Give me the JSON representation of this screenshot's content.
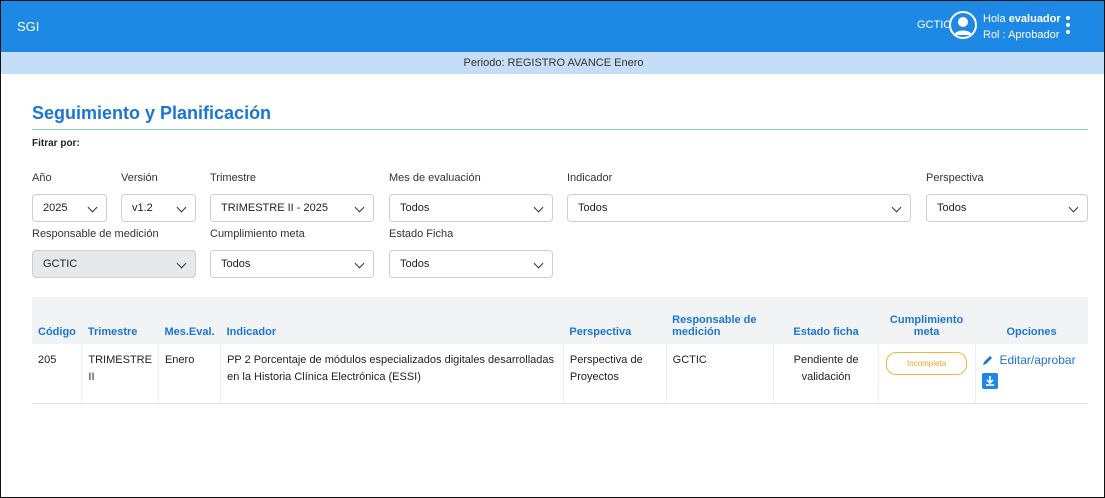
{
  "topbar": {
    "brand": "SGI",
    "org": "GCTIC",
    "greeting_prefix": "Hola",
    "user": "evaluador",
    "role": "Rol : Aprobador"
  },
  "period": "Periodo: REGISTRO AVANCE Enero",
  "page_title": "Seguimiento y Planificación",
  "filter_heading": "Fitrar por:",
  "filters": {
    "anio": {
      "label": "Año",
      "value": "2025"
    },
    "version": {
      "label": "Versión",
      "value": "v1.2"
    },
    "trimestre": {
      "label": "Trimestre",
      "value": "TRIMESTRE II - 2025"
    },
    "mes": {
      "label": "Mes de evaluación",
      "value": "Todos"
    },
    "indicador": {
      "label": "Indicador",
      "value": "Todos"
    },
    "perspectiva": {
      "label": "Perspectiva",
      "value": "Todos"
    },
    "responsable": {
      "label": "Responsable de medición",
      "value": "GCTIC"
    },
    "cumplimiento": {
      "label": "Cumplimiento meta",
      "value": "Todos"
    },
    "estado": {
      "label": "Estado Ficha",
      "value": "Todos"
    }
  },
  "table": {
    "headers": {
      "codigo": "Código",
      "trimestre": "Trimestre",
      "mes": "Mes.Eval.",
      "indicador": "Indicador",
      "perspectiva": "Perspectiva",
      "responsable": "Responsable de medición",
      "estado": "Estado ficha",
      "cumplimiento": "Cumplimiento meta",
      "opciones": "Opciones"
    },
    "rows": [
      {
        "codigo": "205",
        "trimestre": "TRIMESTRE II",
        "mes": "Enero",
        "indicador": "PP 2 Porcentaje de módulos especializados digitales desarrolladas en la Historia Clínica Electrónica (ESSI)",
        "perspectiva": "Perspectiva de Proyectos",
        "responsable": "GCTIC",
        "estado": "Pendiente de validación",
        "cumplimiento": "Incompleta",
        "action_label": "Editar/aprobar"
      }
    ]
  },
  "colors": {
    "primary": "#1e88e5",
    "title": "#1976d2",
    "period_bg": "#c6ddf8",
    "badge": "#f3b73a"
  },
  "icons": [
    "user-avatar-icon",
    "kebab-menu-icon",
    "chevron-down-icon",
    "pencil-icon",
    "download-icon"
  ]
}
